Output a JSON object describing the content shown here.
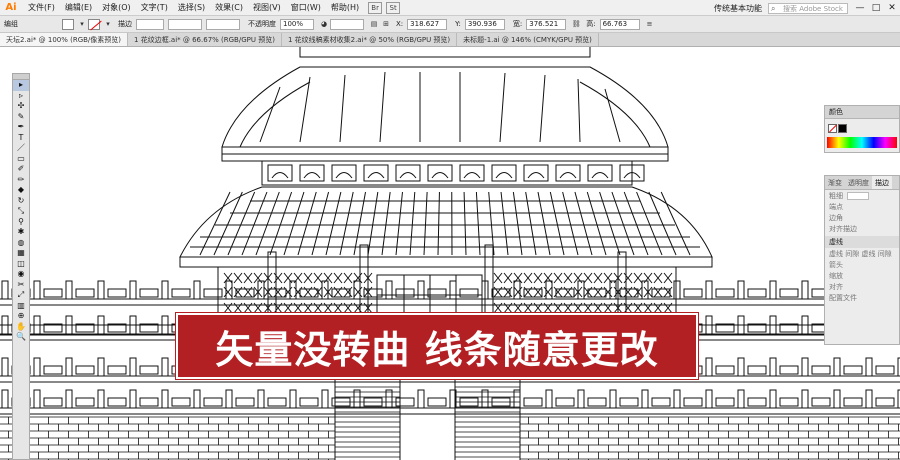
{
  "app": {
    "logo": "Ai"
  },
  "menu": [
    "文件(F)",
    "编辑(E)",
    "对象(O)",
    "文字(T)",
    "选择(S)",
    "效果(C)",
    "视图(V)",
    "窗口(W)",
    "帮助(H)"
  ],
  "bridge_icons": [
    "Br",
    "St"
  ],
  "workspace": {
    "label": "传统基本功能"
  },
  "search": {
    "placeholder": "搜索 Adobe Stock"
  },
  "window_controls": [
    "—",
    "□",
    "✕"
  ],
  "control_bar": {
    "group_label": "编组",
    "stroke_label": "描边",
    "opacity_label": "不透明度",
    "opacity_value": "100%",
    "x_label": "X:",
    "x_value": "318.627",
    "y_label": "Y:",
    "y_value": "390.936",
    "w_label": "宽:",
    "w_value": "376.521",
    "h_label": "高:",
    "h_value": "66.763"
  },
  "tabs": [
    {
      "label": "天坛2.ai* @ 100% (RGB/像素预览)",
      "active": true
    },
    {
      "label": "1 花纹边框.ai* @ 66.67% (RGB/GPU 预览)",
      "active": false
    },
    {
      "label": "1 花纹线稿素材收集2.ai* @ 50% (RGB/GPU 预览)",
      "active": false
    },
    {
      "label": "未标题-1.ai @ 146% (CMYK/GPU 预览)",
      "active": false
    }
  ],
  "tools": [
    "▸",
    "▹",
    "✣",
    "✎",
    "✒",
    "T",
    "／",
    "▭",
    "✐",
    "✏",
    "◆",
    "↻",
    "⤡",
    "⚲",
    "✱",
    "◍",
    "▦",
    "◫",
    "◉",
    "✂",
    "⤢",
    "▥",
    "⊕",
    "✋",
    "🔍"
  ],
  "color_panel": {
    "title": "颜色"
  },
  "stroke_panel": {
    "tabs": [
      "渐变",
      "透明度",
      "描边"
    ],
    "rows": [
      "粗细",
      "端点",
      "边角",
      "对齐描边"
    ],
    "section": "虚线",
    "dash_labels": [
      "虚线",
      "间隙",
      "虚线",
      "间隙"
    ],
    "arrow_label": "箭头",
    "scale_label": "缩放",
    "align_label": "对齐",
    "profile_label": "配置文件"
  },
  "banner": {
    "text": "矢量没转曲 线条随意更改",
    "bg": "#b32024"
  }
}
